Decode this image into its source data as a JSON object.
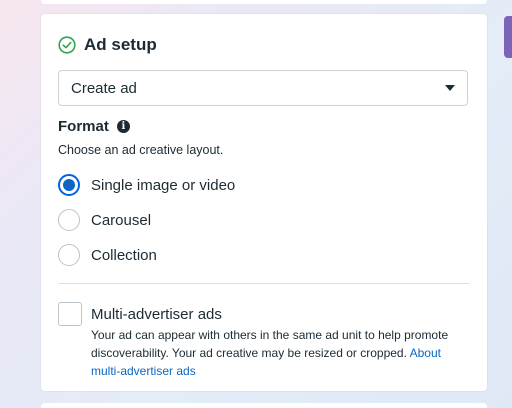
{
  "ad_setup": {
    "title": "Ad setup",
    "status_icon": "check-circle-icon",
    "select": {
      "value": "Create ad",
      "icon": "caret-down-icon"
    },
    "format": {
      "label": "Format",
      "info_icon": "info-icon",
      "description": "Choose an ad creative layout.",
      "options": [
        {
          "label": "Single image or video",
          "selected": true
        },
        {
          "label": "Carousel",
          "selected": false
        },
        {
          "label": "Collection",
          "selected": false
        }
      ]
    },
    "multi_advertiser": {
      "label": "Multi-advertiser ads",
      "checked": false,
      "description": "Your ad can appear with others in the same ad unit to help promote discoverability. Your ad creative may be resized or cropped.",
      "link": "About multi-advertiser ads"
    }
  },
  "colors": {
    "accent": "#0a66c2",
    "success": "#31a24c",
    "text": "#1c2b33",
    "edge_accent": "#7b64b7"
  }
}
